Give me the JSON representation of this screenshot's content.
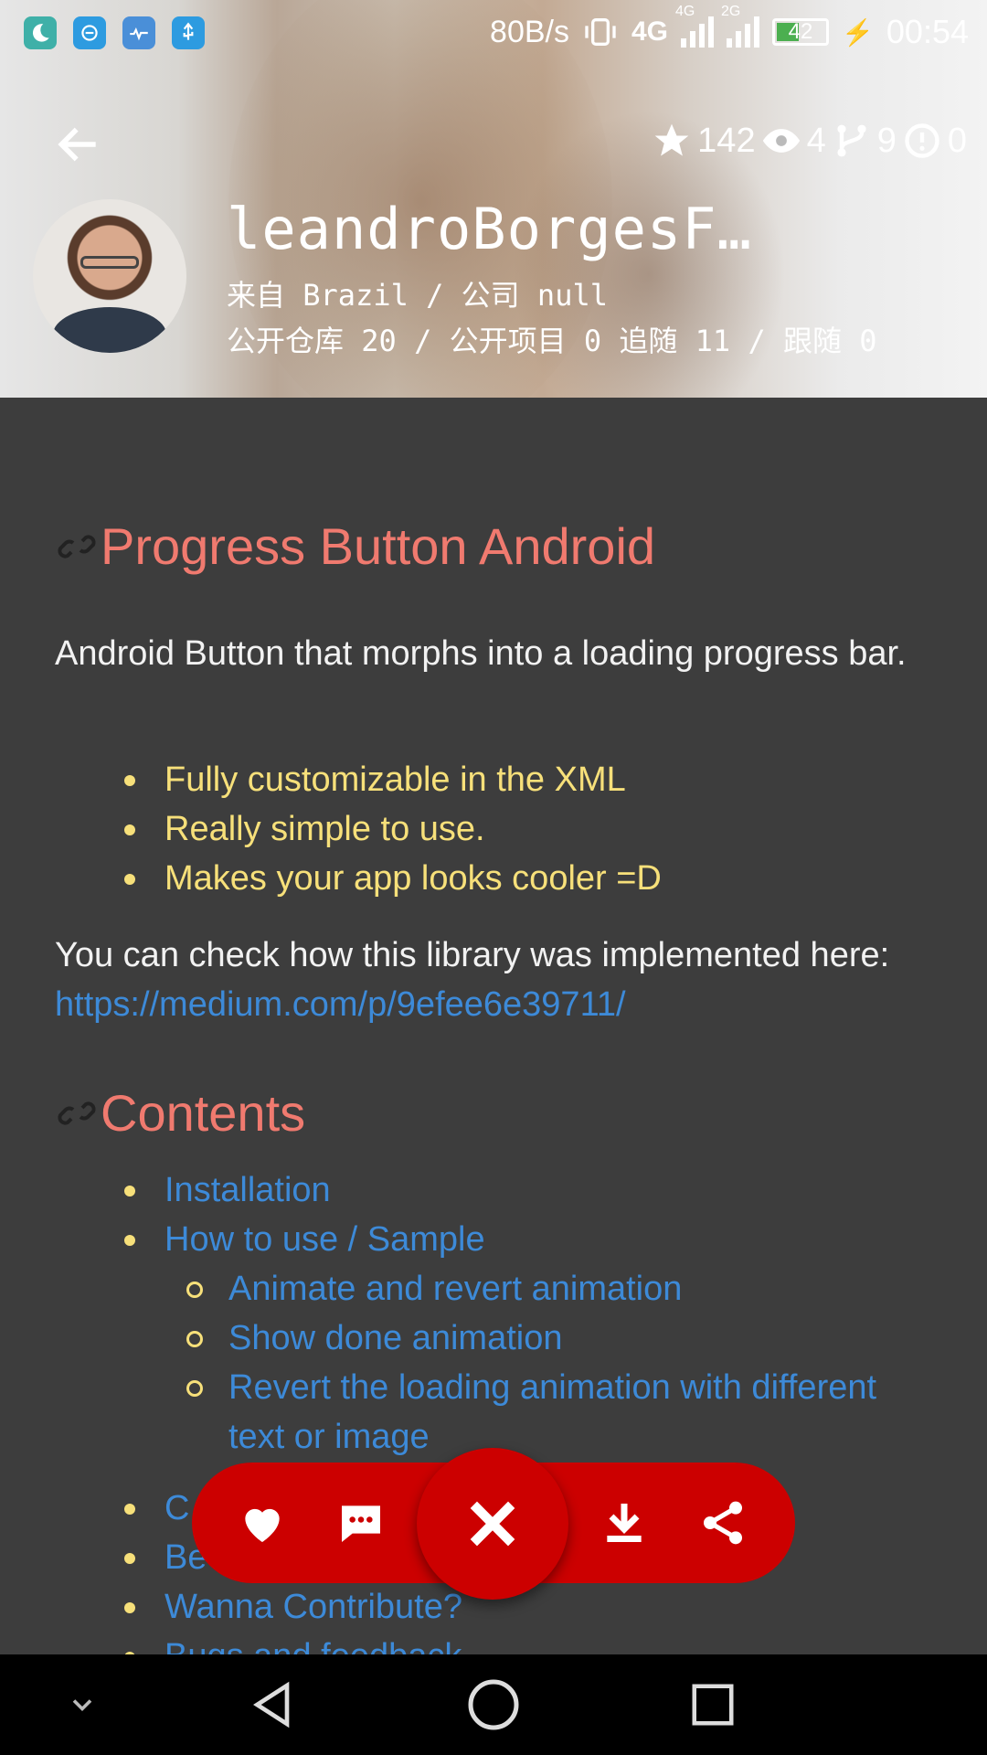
{
  "status_bar": {
    "net_speed": "80B/s",
    "net_type_1": "4G",
    "net_type_2": "4G",
    "net_type_3": "2G",
    "battery": "42",
    "time": "00:54"
  },
  "header": {
    "stats": {
      "stars": "142",
      "watchers": "4",
      "forks": "9",
      "issues": "0"
    },
    "name": "leandroBorgesF…",
    "location_line": "来自 Brazil / 公司 null",
    "counts_line": "公开仓库 20 / 公开项目 0 追随 11 / 跟随 0"
  },
  "readme": {
    "title": "Progress Button Android",
    "description": "Android Button that morphs into a loading progress bar.",
    "features": [
      "Fully customizable in the XML",
      "Really simple to use.",
      "Makes your app looks cooler =D"
    ],
    "impl_text": "You can check how this library was implemented here: ",
    "impl_link": "https://medium.com/p/9efee6e39711/",
    "contents_title": "Contents",
    "contents": {
      "installation": "Installation",
      "how_to_use": "How to use / Sample",
      "sub_animate": "Animate and revert animation",
      "sub_done": "Show done animation",
      "sub_revert": "Revert the loading animation with different text or image",
      "item_c": "C",
      "item_be": "Be",
      "contribute": "Wanna Contribute?",
      "bugs": "Bugs and feedback"
    }
  },
  "fab": {
    "like": "heart-icon",
    "comment": "comment-icon",
    "close": "close-icon",
    "download": "download-icon",
    "share": "share-icon",
    "color": "#cc0000"
  },
  "colors": {
    "heading": "#f07a6f",
    "bullet_text": "#f7e07a",
    "link": "#3d8ad8",
    "background": "#3d3d3d"
  }
}
